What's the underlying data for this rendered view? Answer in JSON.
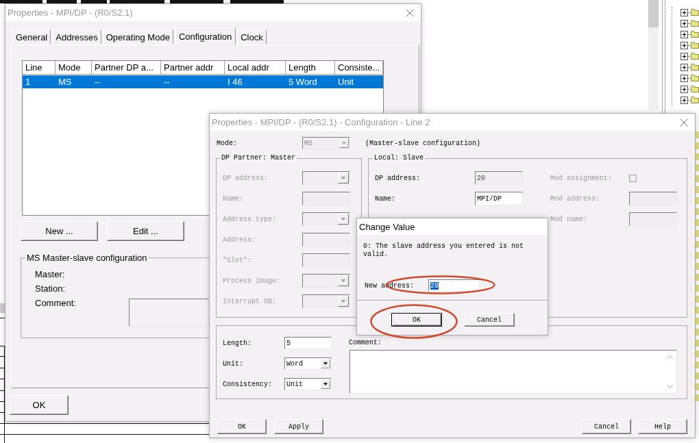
{
  "properties_window": {
    "title": "Properties - MPI/DP - (R0/S2.1)",
    "active": false,
    "tabs": [
      {
        "label": "General",
        "selected": false
      },
      {
        "label": "Addresses",
        "selected": false
      },
      {
        "label": "Operating Mode",
        "selected": false
      },
      {
        "label": "Configuration",
        "selected": true
      },
      {
        "label": "Clock",
        "selected": false
      }
    ],
    "table": {
      "columns": [
        "Line",
        "Mode",
        "Partner DP a...",
        "Partner addr",
        "Local addr",
        "Length",
        "Consiste..."
      ],
      "rows": [
        {
          "cells": [
            "1",
            "MS",
            "--",
            "--",
            "I 46",
            "5 Word",
            "Unit"
          ],
          "selected": true
        }
      ]
    },
    "buttons": [
      "New ...",
      "Edit ..."
    ],
    "group": {
      "title": "MS Master-slave configuration",
      "fields": [
        {
          "label": "Master:",
          "kind": "info"
        },
        {
          "label": "Station:",
          "kind": "info"
        },
        {
          "label": "Comment:",
          "kind": "textarea"
        }
      ]
    },
    "footer_buttons": [
      "OK"
    ]
  },
  "line_window": {
    "title": "Properties - MPI/DP - (R0/S2.1) - Configuration - Line 2",
    "active": false,
    "mode": {
      "label": "Mode:",
      "value": "MS",
      "disabled": true,
      "description": "(Master-slave configuration)"
    },
    "partner_group": {
      "title": "DP Partner: Master",
      "fields": [
        {
          "label": "DP address:",
          "kind": "combo",
          "disabled": true
        },
        {
          "label": "Name:",
          "kind": "text",
          "disabled": true
        },
        {
          "label": "Address type:",
          "kind": "combo",
          "disabled": true
        },
        {
          "label": "Address:",
          "kind": "text",
          "disabled": true
        },
        {
          "label": "\"Slot\":",
          "kind": "text",
          "disabled": true
        },
        {
          "label": "Process image:",
          "kind": "combo",
          "disabled": true
        },
        {
          "label": "Interrupt OB:",
          "kind": "combo",
          "disabled": true
        }
      ]
    },
    "local_group": {
      "title": "Local: Slave",
      "fields": [
        {
          "label": "DP address:",
          "kind": "text",
          "value": "20",
          "read_only": true
        },
        {
          "label": "Name:",
          "kind": "text",
          "value": "MPI/DP",
          "read_only": false
        }
      ],
      "module_fields": [
        {
          "label": "Mod assignment:",
          "kind": "checkbox",
          "checked": false,
          "disabled": true
        },
        {
          "label": "Mod address:",
          "kind": "text",
          "disabled": true
        },
        {
          "label": "Mod name:",
          "kind": "text",
          "disabled": true
        }
      ]
    },
    "data_group": {
      "fields": [
        {
          "label": "Length:",
          "kind": "text",
          "value": "5",
          "disabled": false
        },
        {
          "label": "Unit:",
          "kind": "combo",
          "value": "Word",
          "disabled": false
        },
        {
          "label": "Consistency:",
          "kind": "combo",
          "value": "Unit",
          "disabled": false
        }
      ],
      "comment_label": "Comment:"
    },
    "buttons_left": [
      "OK",
      "Apply"
    ],
    "buttons_right": [
      "Cancel",
      "Help"
    ]
  },
  "change_value_dialog": {
    "title": "Change Value",
    "active": true,
    "message": "0: The slave address you entered is not valid.",
    "field": {
      "label": "New address:",
      "value": "29",
      "selected": true,
      "circled": true
    },
    "buttons": [
      {
        "label": "OK",
        "default": true,
        "circled": true
      },
      {
        "label": "Cancel",
        "default": false,
        "circled": false
      }
    ]
  }
}
